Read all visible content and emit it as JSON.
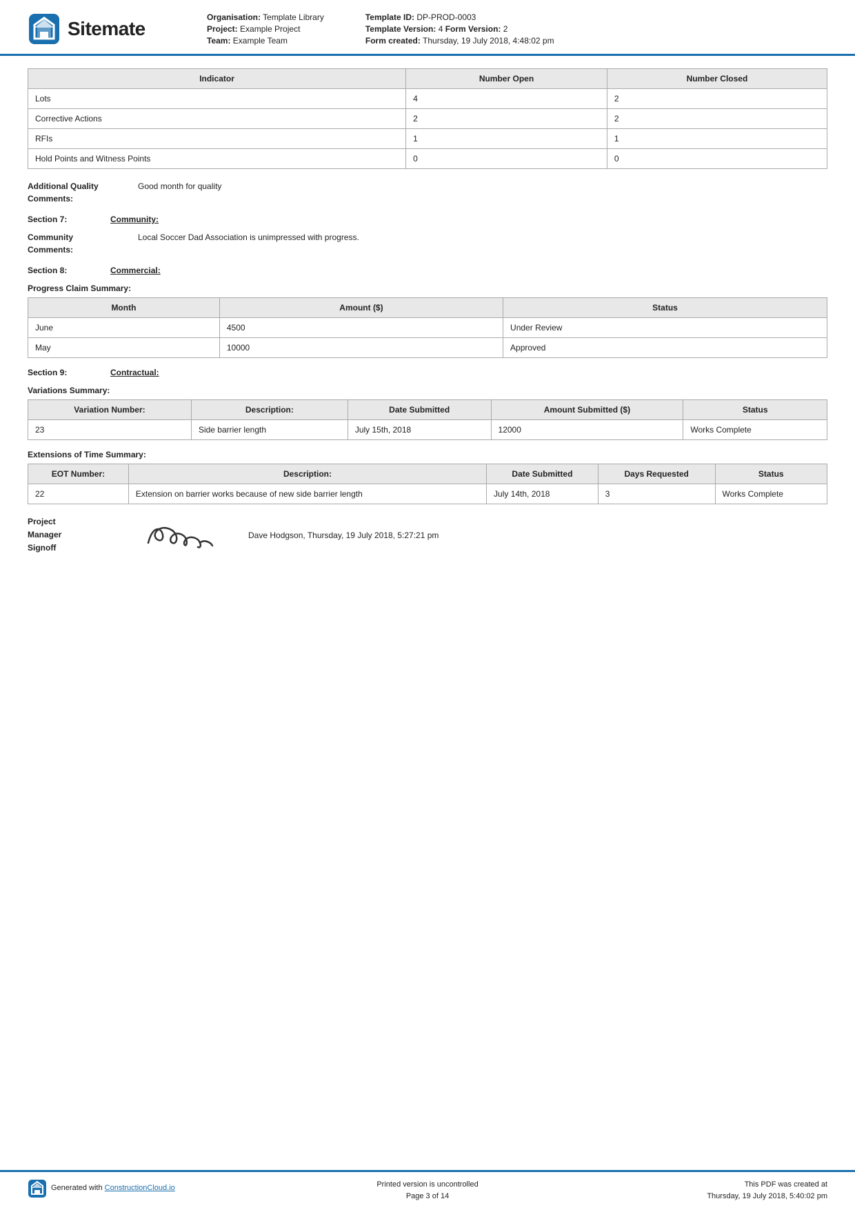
{
  "header": {
    "logo_text": "Sitemate",
    "org_label": "Organisation:",
    "org_value": "Template Library",
    "project_label": "Project:",
    "project_value": "Example Project",
    "team_label": "Team:",
    "team_value": "Example Team",
    "template_id_label": "Template ID:",
    "template_id_value": "DP-PROD-0003",
    "template_version_label": "Template Version:",
    "template_version_value": "4",
    "form_version_label": "Form Version:",
    "form_version_value": "2",
    "form_created_label": "Form created:",
    "form_created_value": "Thursday, 19 July 2018, 4:48:02 pm"
  },
  "indicator_table": {
    "columns": [
      "Indicator",
      "Number Open",
      "Number Closed"
    ],
    "rows": [
      [
        "Lots",
        "4",
        "2"
      ],
      [
        "Corrective Actions",
        "2",
        "2"
      ],
      [
        "RFIs",
        "1",
        "1"
      ],
      [
        "Hold Points and Witness Points",
        "0",
        "0"
      ]
    ]
  },
  "additional_quality": {
    "label": "Additional Quality Comments:",
    "value": "Good month for quality"
  },
  "section7": {
    "number": "Section 7:",
    "title": "Community:"
  },
  "community_comments": {
    "label": "Community Comments:",
    "value": "Local Soccer Dad Association is unimpressed with progress."
  },
  "section8": {
    "number": "Section 8:",
    "title": "Commercial:"
  },
  "progress_claim": {
    "title": "Progress Claim Summary:",
    "columns": [
      "Month",
      "Amount ($)",
      "Status"
    ],
    "rows": [
      [
        "June",
        "4500",
        "Under Review"
      ],
      [
        "May",
        "10000",
        "Approved"
      ]
    ]
  },
  "section9": {
    "number": "Section 9:",
    "title": "Contractual:"
  },
  "variations": {
    "title": "Variations Summary:",
    "columns": [
      "Variation Number:",
      "Description:",
      "Date Submitted",
      "Amount Submitted ($)",
      "Status"
    ],
    "rows": [
      [
        "23",
        "Side barrier length",
        "July 15th, 2018",
        "12000",
        "Works Complete"
      ]
    ]
  },
  "extensions": {
    "title": "Extensions of Time Summary:",
    "columns": [
      "EOT Number:",
      "Description:",
      "Date Submitted",
      "Days Requested",
      "Status"
    ],
    "rows": [
      [
        "22",
        "Extension on barrier works because of new side barrier length",
        "July 14th, 2018",
        "3",
        "Works Complete"
      ]
    ]
  },
  "project_manager": {
    "label_line1": "Project",
    "label_line2": "Manager",
    "label_line3": "Signoff",
    "signature_text": "Camm",
    "info": "Dave Hodgson, Thursday, 19 July 2018, 5:27:21 pm"
  },
  "footer": {
    "generated_prefix": "Generated with ",
    "generated_link": "ConstructionCloud.io",
    "center_line1": "Printed version is uncontrolled",
    "center_line2": "Page 3 of 14",
    "right_line1": "This PDF was created at",
    "right_line2": "Thursday, 19 July 2018, 5:40:02 pm"
  }
}
